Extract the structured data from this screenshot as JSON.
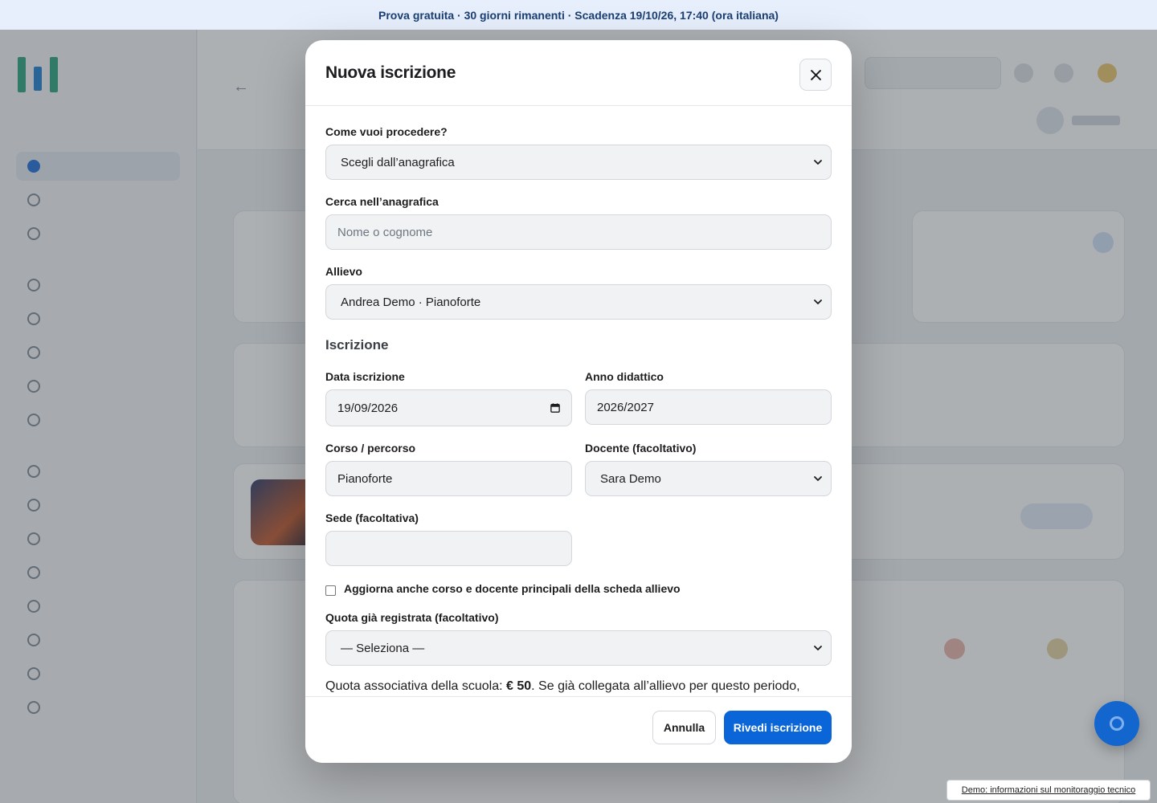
{
  "banner": {
    "text": "Prova gratuita · 30 giorni rimanenti · Scadenza 19/10/26, 17:40 (ora italiana)"
  },
  "modal": {
    "title": "Nuova iscrizione",
    "close_icon": "close-icon",
    "procedure": {
      "label": "Come vuoi procedere?",
      "selected": "Scegli dall’anagrafica"
    },
    "search": {
      "label": "Cerca nell’anagrafica",
      "placeholder": "Nome o cognome",
      "value": ""
    },
    "student": {
      "label": "Allievo",
      "selected": "Andrea Demo · Pianoforte"
    },
    "enrollment_section": "Iscrizione",
    "enrollment_date": {
      "label": "Data iscrizione",
      "value": "19/09/2026",
      "icon": "calendar-icon"
    },
    "school_year": {
      "label": "Anno didattico",
      "value": "2026/2027"
    },
    "course": {
      "label": "Corso / percorso",
      "value": "Pianoforte"
    },
    "teacher": {
      "label": "Docente (facoltativo)",
      "selected": "Sara Demo"
    },
    "location": {
      "label": "Sede (facoltativa)",
      "value": ""
    },
    "update_checkbox": {
      "label": "Aggiorna anche corso e docente principali della scheda allievo",
      "checked": false
    },
    "fee": {
      "label": "Quota già registrata (facoltativo)",
      "selected": "— Seleziona —"
    },
    "fee_info": {
      "prefix": "Quota associativa della scuola: ",
      "amount": "€ 50",
      "suffix": ". Se già collegata all’allievo per questo periodo,"
    },
    "footer": {
      "cancel_label": "Annulla",
      "submit_label": "Rivedi iscrizione"
    }
  },
  "demo_link": {
    "text": "Demo: informazioni sul monitoraggio tecnico"
  },
  "colors": {
    "primary": "#0a66d8",
    "banner_bg": "#e6effb",
    "banner_text": "#1c3f73"
  }
}
